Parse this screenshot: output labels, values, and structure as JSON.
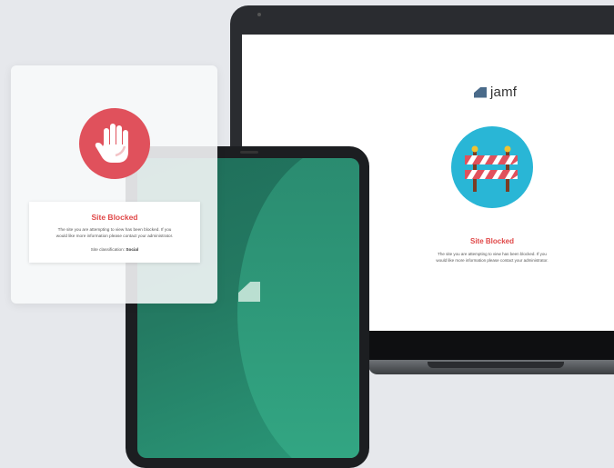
{
  "laptop": {
    "brand": "jamf",
    "block_title": "Site Blocked",
    "block_message_line1": "The site you are attempting to view has been blocked. If you",
    "block_message_line2": "would like more information please contact your administrator."
  },
  "tablet": {
    "logo": "jamf-mark-icon"
  },
  "phone": {
    "block_title": "Site Blocked",
    "block_message_line1": "The site you are attempting to view has been blocked. If you",
    "block_message_line2": "would like more information please contact your administrator.",
    "classification_label": "Site classification:",
    "classification_value": "Social"
  },
  "colors": {
    "alert_red": "#e04848",
    "hand_circle": "#e0515c",
    "barrier_circle": "#29b6d6",
    "tablet_green": "#247a62"
  }
}
